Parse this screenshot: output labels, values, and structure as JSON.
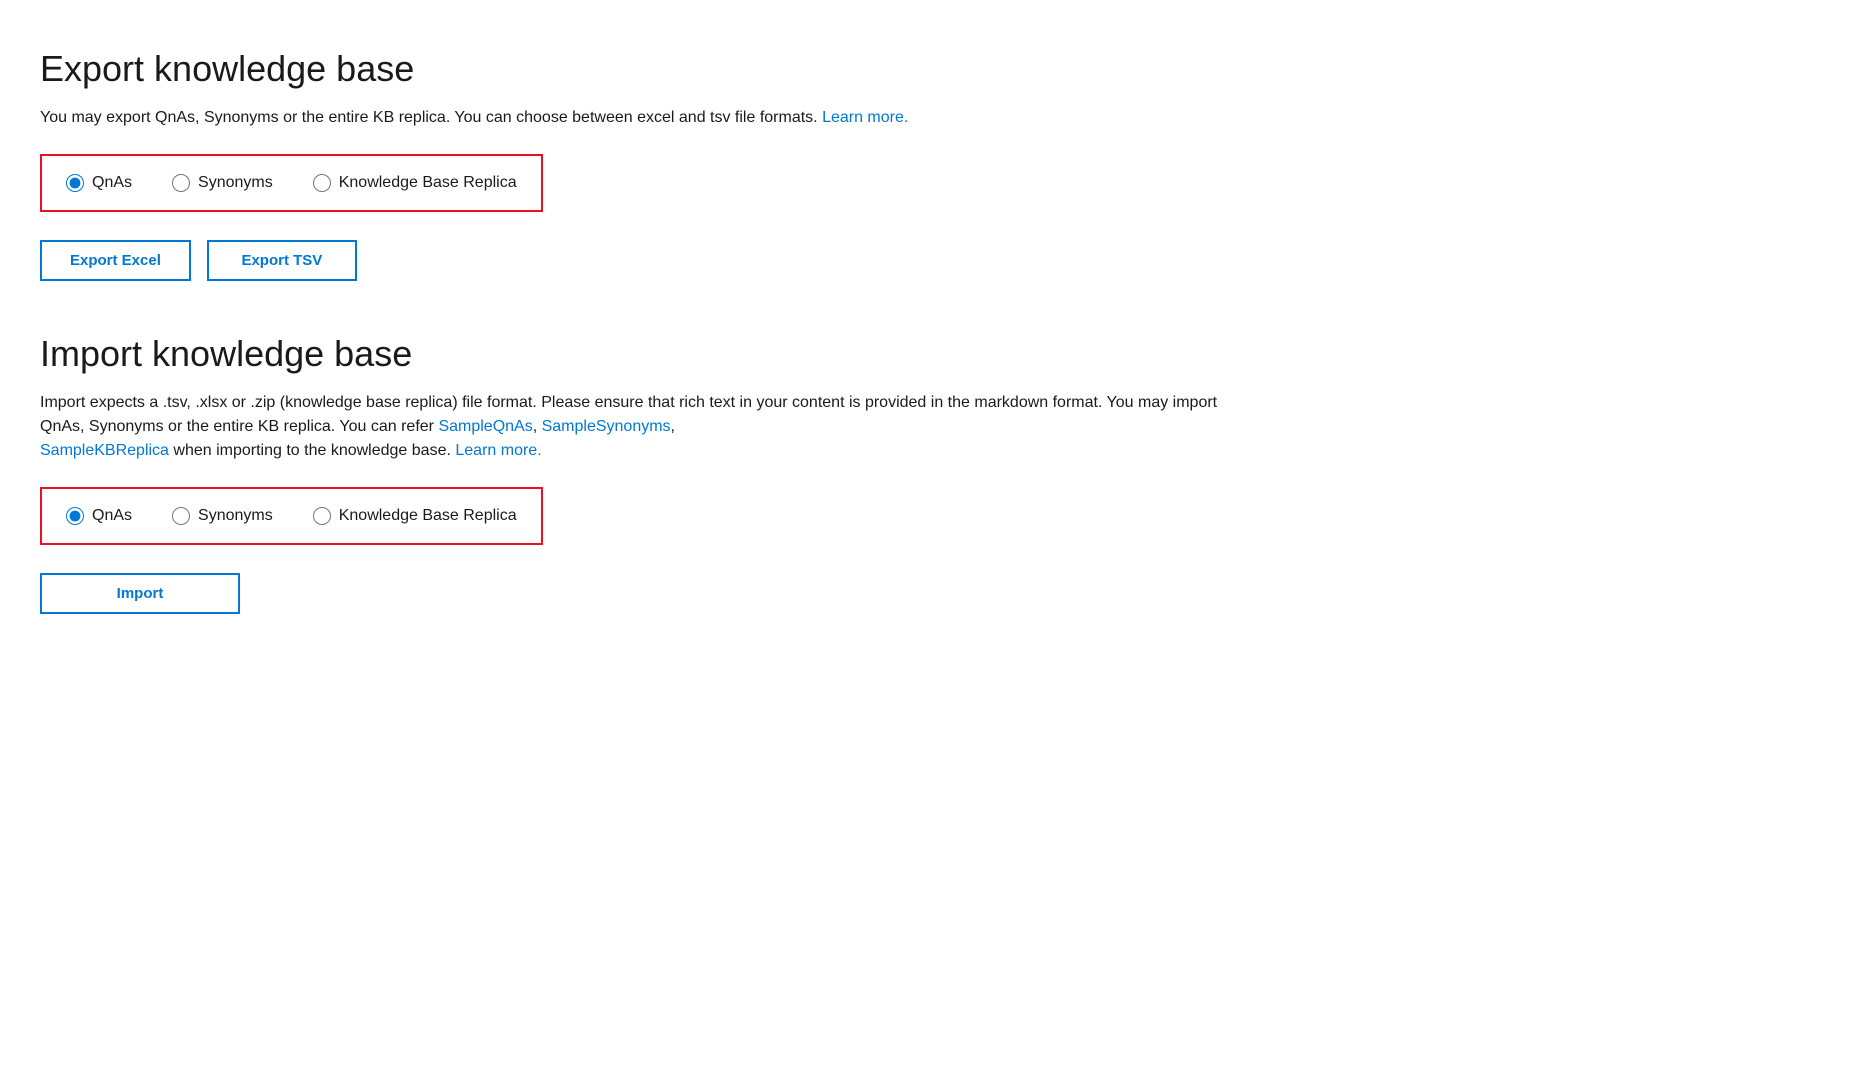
{
  "export_section": {
    "title": "Export knowledge base",
    "description": "You may export QnAs, Synonyms or the entire KB replica. You can choose between excel and tsv file formats.",
    "description_link_text": "Learn more.",
    "description_link_href": "#",
    "radio_options": [
      {
        "id": "export-qnas",
        "label": "QnAs",
        "checked": true
      },
      {
        "id": "export-synonyms",
        "label": "Synonyms",
        "checked": false
      },
      {
        "id": "export-kbreplica",
        "label": "Knowledge Base Replica",
        "checked": false
      }
    ],
    "buttons": [
      {
        "id": "export-excel-btn",
        "label": "Export Excel"
      },
      {
        "id": "export-tsv-btn",
        "label": "Export TSV"
      }
    ]
  },
  "import_section": {
    "title": "Import knowledge base",
    "description_part1": "Import expects a .tsv, .xlsx or .zip (knowledge base replica) file format. Please ensure that rich text in your content is provided in the markdown format. You may import QnAs, Synonyms or the entire KB replica. You can refer",
    "description_link1_text": "SampleQnAs",
    "description_link1_href": "#",
    "description_link2_text": "SampleSynonyms",
    "description_link2_href": "#",
    "description_link3_text": "SampleKBReplica",
    "description_link3_href": "#",
    "description_part2": "when importing to the knowledge base.",
    "description_link4_text": "Learn more.",
    "description_link4_href": "#",
    "radio_options": [
      {
        "id": "import-qnas",
        "label": "QnAs",
        "checked": true
      },
      {
        "id": "import-synonyms",
        "label": "Synonyms",
        "checked": false
      },
      {
        "id": "import-kbreplica",
        "label": "Knowledge Base Replica",
        "checked": false
      }
    ],
    "import_button_label": "Import"
  }
}
